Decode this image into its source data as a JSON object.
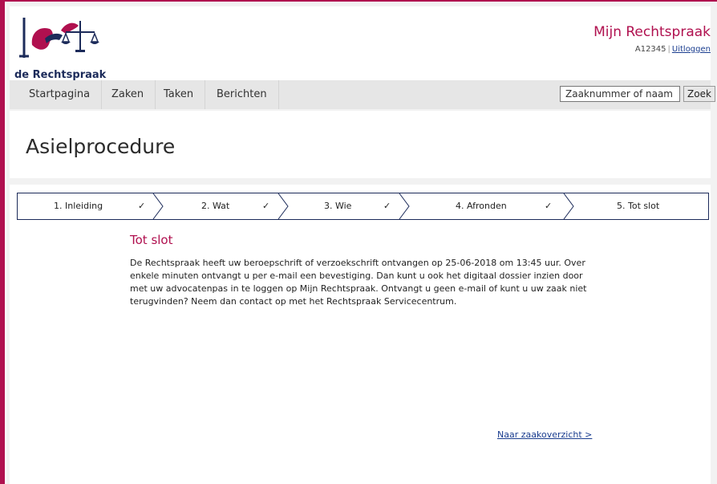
{
  "header": {
    "logo_text": "de Rechtspraak",
    "site_title": "Mijn Rechtspraak",
    "user_id": "A12345",
    "logout_label": "Uitloggen"
  },
  "nav": {
    "items": [
      "Startpagina",
      "Zaken",
      "Taken",
      "Berichten"
    ],
    "search_placeholder": "Zaaknummer of naam",
    "search_button": "Zoek"
  },
  "page": {
    "title": "Asielprocedure"
  },
  "steps": [
    {
      "label": "1. Inleiding",
      "done": true
    },
    {
      "label": "2. Wat",
      "done": true
    },
    {
      "label": "3. Wie",
      "done": true
    },
    {
      "label": "4. Afronden",
      "done": true
    },
    {
      "label": "5. Tot slot",
      "done": false
    }
  ],
  "check_glyph": "✓",
  "content": {
    "heading": "Tot slot",
    "body": "De Rechtspraak heeft uw beroepschrift of verzoekschrift ontvangen op 25-06-2018 om 13:45 uur. Over enkele minuten ontvangt u per e-mail een bevestiging. Dan kunt u ook het digitaal dossier inzien door met uw advocatenpas in te loggen op Mijn Rechtspraak. Ontvangt u geen e-mail of kunt u uw zaak niet terugvinden? Neem dan contact op met het Rechtspraak Servicecentrum.",
    "link": "Naar zaakoverzicht >"
  },
  "colors": {
    "brand": "#b0104f",
    "navy": "#1c2b5a",
    "link": "#1a3d8f",
    "check": "#2f7a7a"
  }
}
